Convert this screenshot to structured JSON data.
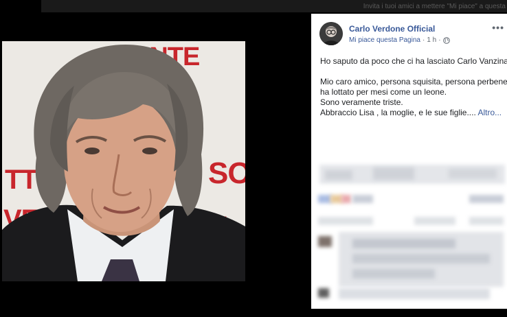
{
  "background_text": "Invita i tuoi amici a mettere \"Mi piace\" a questa",
  "post": {
    "page_name": "Carlo Verdone Official",
    "like_page": "Mi piace questa Pagina",
    "separator": "·",
    "time": "1 h",
    "time_separator": "·",
    "more_options": "•••",
    "lines": [
      "Ho saputo da poco che ci ha lasciato Carlo Vanzina.",
      "",
      "Mio caro amico, persona squisita, persona perbene,",
      "ha lottato per mesi come un leone.",
      "Sono veramente triste.",
      "Abbraccio Lisa , la moglie, e le sue figlie...."
    ],
    "more_link": "Altro..."
  },
  "photo": {
    "poster_fragments": [
      "ENTE",
      "SO",
      "TTU",
      "VE",
      "I"
    ]
  }
}
